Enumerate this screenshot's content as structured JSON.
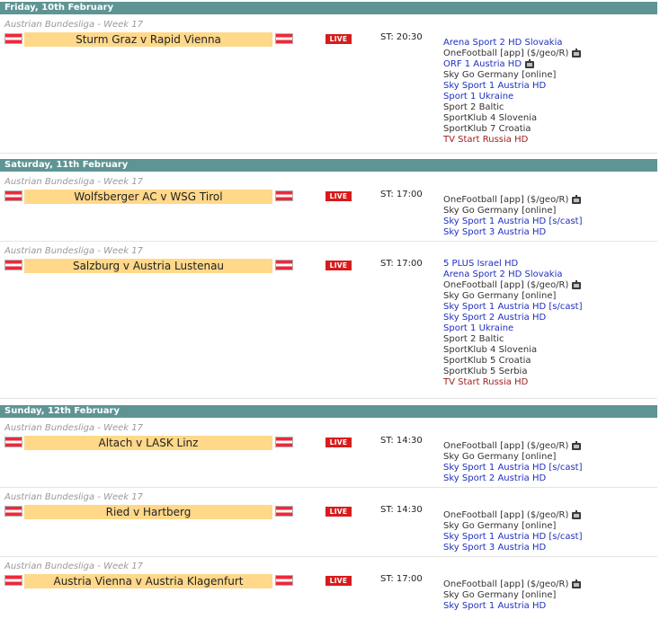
{
  "days": [
    {
      "date": "Friday, 10th February"
    },
    {
      "date": "Saturday, 11th February"
    },
    {
      "date": "Sunday, 12th February"
    }
  ],
  "live_label": "LIVE",
  "matches": [
    {
      "league": "Austrian Bundesliga - Week 17",
      "teams": "Sturm Graz v Rapid Vienna",
      "start": "ST: 20:30",
      "channels": [
        {
          "name": "Arena Sport 2 HD Slovakia",
          "color": "#1f2fbf",
          "tv": false
        },
        {
          "name": "OneFootball [app] ($/geo/R)",
          "color": "#333333",
          "tv": true
        },
        {
          "name": "ORF 1 Austria HD",
          "color": "#1f2fbf",
          "tv": true
        },
        {
          "name": "Sky Go Germany [online]",
          "color": "#333333",
          "tv": false
        },
        {
          "name": "Sky Sport 1 Austria HD",
          "color": "#1f2fbf",
          "tv": false
        },
        {
          "name": "Sport 1 Ukraine",
          "color": "#1f2fbf",
          "tv": false
        },
        {
          "name": "Sport 2 Baltic",
          "color": "#333333",
          "tv": false
        },
        {
          "name": "SportKlub 4 Slovenia",
          "color": "#333333",
          "tv": false
        },
        {
          "name": "SportKlub 7 Croatia",
          "color": "#333333",
          "tv": false
        },
        {
          "name": "TV Start Russia HD",
          "color": "#a02020",
          "tv": false
        }
      ]
    },
    {
      "league": "Austrian Bundesliga - Week 17",
      "teams": "Wolfsberger AC v WSG Tirol",
      "start": "ST: 17:00",
      "channels": [
        {
          "name": "OneFootball [app] ($/geo/R)",
          "color": "#333333",
          "tv": true
        },
        {
          "name": "Sky Go Germany [online]",
          "color": "#333333",
          "tv": false
        },
        {
          "name": "Sky Sport 1 Austria HD [s/cast]",
          "color": "#1f2fbf",
          "tv": false
        },
        {
          "name": "Sky Sport 3 Austria HD",
          "color": "#1f2fbf",
          "tv": false
        }
      ]
    },
    {
      "league": "Austrian Bundesliga - Week 17",
      "teams": "Salzburg v Austria Lustenau",
      "start": "ST: 17:00",
      "channels": [
        {
          "name": "5 PLUS Israel HD",
          "color": "#1f2fbf",
          "tv": false
        },
        {
          "name": "Arena Sport 2 HD Slovakia",
          "color": "#1f2fbf",
          "tv": false
        },
        {
          "name": "OneFootball [app] ($/geo/R)",
          "color": "#333333",
          "tv": true
        },
        {
          "name": "Sky Go Germany [online]",
          "color": "#333333",
          "tv": false
        },
        {
          "name": "Sky Sport 1 Austria HD [s/cast]",
          "color": "#1f2fbf",
          "tv": false
        },
        {
          "name": "Sky Sport 2 Austria HD",
          "color": "#1f2fbf",
          "tv": false
        },
        {
          "name": "Sport 1 Ukraine",
          "color": "#1f2fbf",
          "tv": false
        },
        {
          "name": "Sport 2 Baltic",
          "color": "#333333",
          "tv": false
        },
        {
          "name": "SportKlub 4 Slovenia",
          "color": "#333333",
          "tv": false
        },
        {
          "name": "SportKlub 5 Croatia",
          "color": "#333333",
          "tv": false
        },
        {
          "name": "SportKlub 5 Serbia",
          "color": "#333333",
          "tv": false
        },
        {
          "name": "TV Start Russia HD",
          "color": "#a02020",
          "tv": false
        }
      ]
    },
    {
      "league": "Austrian Bundesliga - Week 17",
      "teams": "Altach v LASK Linz",
      "start": "ST: 14:30",
      "channels": [
        {
          "name": "OneFootball [app] ($/geo/R)",
          "color": "#333333",
          "tv": true
        },
        {
          "name": "Sky Go Germany [online]",
          "color": "#333333",
          "tv": false
        },
        {
          "name": "Sky Sport 1 Austria HD [s/cast]",
          "color": "#1f2fbf",
          "tv": false
        },
        {
          "name": "Sky Sport 2 Austria HD",
          "color": "#1f2fbf",
          "tv": false
        }
      ]
    },
    {
      "league": "Austrian Bundesliga - Week 17",
      "teams": "Ried v Hartberg",
      "start": "ST: 14:30",
      "channels": [
        {
          "name": "OneFootball [app] ($/geo/R)",
          "color": "#333333",
          "tv": true
        },
        {
          "name": "Sky Go Germany [online]",
          "color": "#333333",
          "tv": false
        },
        {
          "name": "Sky Sport 1 Austria HD [s/cast]",
          "color": "#1f2fbf",
          "tv": false
        },
        {
          "name": "Sky Sport 3 Austria HD",
          "color": "#1f2fbf",
          "tv": false
        }
      ]
    },
    {
      "league": "Austrian Bundesliga - Week 17",
      "teams": "Austria Vienna v Austria Klagenfurt",
      "start": "ST: 17:00",
      "channels": [
        {
          "name": "OneFootball [app] ($/geo/R)",
          "color": "#333333",
          "tv": true
        },
        {
          "name": "Sky Go Germany [online]",
          "color": "#333333",
          "tv": false
        },
        {
          "name": "Sky Sport 1 Austria HD",
          "color": "#1f2fbf",
          "tv": false
        }
      ]
    }
  ]
}
